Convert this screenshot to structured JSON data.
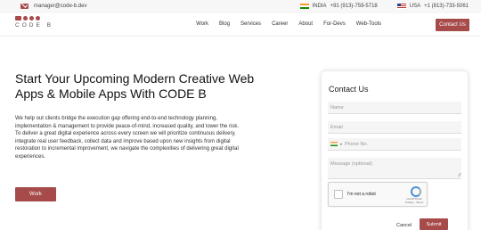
{
  "topbar": {
    "email": "manager@code-b.dev",
    "india": {
      "label": "INDIA",
      "phone": "+91 (913)-759-5718"
    },
    "usa": {
      "label": "USA",
      "phone": "+1 (813)-733-5061"
    }
  },
  "nav": {
    "logo_text": "CODE B",
    "items": [
      "Work",
      "Blog",
      "Services",
      "Career",
      "About",
      "For-Devs",
      "Web-Tools"
    ],
    "cta": "Contact Us"
  },
  "hero": {
    "title": "Start Your Upcoming Modern Creative Web Apps & Mobile Apps With CODE B",
    "description": "We help out clients bridge the execution gap offering end-to-end technology planning, implementation & management to provide peace-of-mind, increased quality, and lower the risk. To deliver a great digital experience across every screen we will prioritize continuous delivery, integrate real user feedback, collect data and improve based upon new insights from digital restoration to incremental improvement, we navigate the complexities of delivering great digital experiences.",
    "work_button": "Work"
  },
  "contact_form": {
    "title": "Contact Us",
    "name_placeholder": "Name",
    "email_placeholder": "Email",
    "phone_placeholder": "Phone No.",
    "message_placeholder": "Message (optional)",
    "captcha_label": "I'm not a robot",
    "captcha_brand": "reCAPTCHA",
    "captcha_terms": "Privacy - Terms",
    "cancel": "Cancel",
    "submit": "Submit"
  },
  "colors": {
    "accent": "#a64a4a"
  }
}
